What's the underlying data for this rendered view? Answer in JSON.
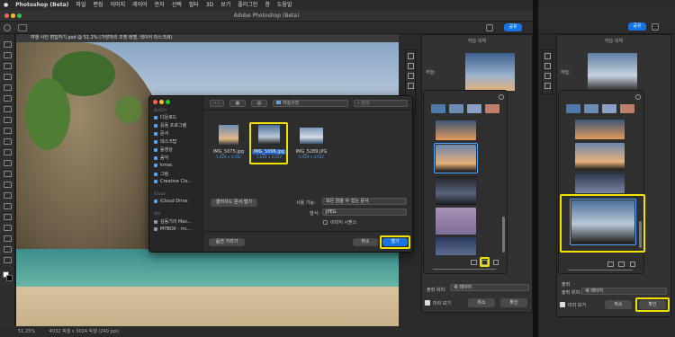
{
  "menubar": {
    "app": "Photoshop (Beta)",
    "items": [
      "파일",
      "편집",
      "이미지",
      "레이어",
      "문자",
      "선택",
      "필터",
      "3D",
      "보기",
      "플러그인",
      "창",
      "도움말"
    ]
  },
  "window": {
    "title": "Adobe Photoshop (Beta)"
  },
  "toolbar": {
    "share_label": "공유"
  },
  "document": {
    "tab_title": "여행 사진 편집하기.psd @ 51.2% (가장자리 조명 레벨, 레이어 마스크/8)",
    "status_zoom": "51.25%",
    "status_info": "4032 픽셀 x 3024 픽셀 (240 ppi)"
  },
  "panel1": {
    "title": "하늘 대체",
    "hint": "하늘 레이어를 드래그하여 이동합니다.",
    "sky_label": "하늘:",
    "output_label": "출력",
    "output_to_label": "출력 위치:",
    "output_to_value": "새 레이어",
    "preview_label": "미리 보기",
    "cancel": "취소",
    "ok": "확인"
  },
  "panel2": {
    "title": "하늘 대체",
    "sky_label": "하늘:",
    "output_label": "출력",
    "output_to_label": "출력 위치:",
    "output_to_value": "새 레이어",
    "preview_label": "미리 보기",
    "cancel": "취소",
    "ok": "확인"
  },
  "dialog": {
    "folder": "하늘사진",
    "search_placeholder": "검색",
    "sidebar": {
      "favorites_title": "즐겨찾기",
      "favorites": [
        "다운로드",
        "응용 프로그램",
        "문서",
        "데스크탑",
        "동영상",
        "음악",
        "kmac",
        "그림",
        "Creative Clo..."
      ],
      "icloud_title": "iCloud",
      "icloud": [
        "iCloud Drive"
      ],
      "locations_title": "위치",
      "locations": [
        "김동기의 Mac...",
        "MYBOX - mi..."
      ]
    },
    "files": [
      {
        "name": "IMG_5075.jpg",
        "meta": "5,024 x 4,032"
      },
      {
        "name": "IMG_5096.jpg",
        "meta": "5,024 x 4,032"
      },
      {
        "name": "IMG_5289.JPG",
        "meta": "5,024 x 4,032"
      }
    ],
    "cloud_docs_button": "클라우드 문서 열기",
    "enable_label": "사용 가능:",
    "enable_value": "모든 읽을 수 있는 문서",
    "format_label": "형식:",
    "format_value": "JPEG",
    "image_sequence_label": "이미지 시퀀스",
    "hide_options": "옵션 가리기",
    "cancel": "취소",
    "open": "열기"
  }
}
